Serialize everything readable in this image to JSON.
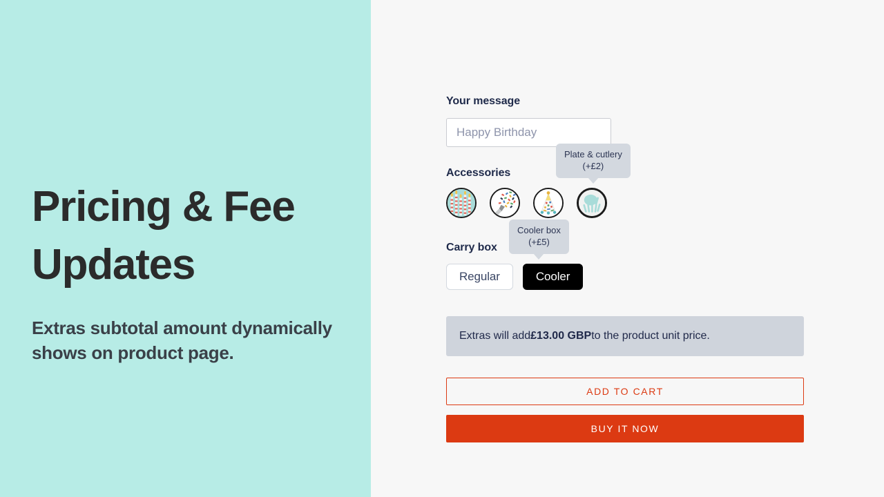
{
  "promo": {
    "headline": "Pricing & Fee Updates",
    "subheadline": "Extras subtotal amount dynamically shows on product page.",
    "background_color": "#B7ECE6"
  },
  "product_form": {
    "message": {
      "label": "Your message",
      "placeholder": "Happy Birthday",
      "value": ""
    },
    "accessories": {
      "label": "Accessories",
      "tooltip": {
        "name": "Plate & cutlery",
        "price": "(+£2)"
      },
      "options": [
        {
          "icon": "birthday-candles-icon",
          "selected": false
        },
        {
          "icon": "confetti-sprinkles-icon",
          "selected": false
        },
        {
          "icon": "party-hat-icon",
          "selected": false
        },
        {
          "icon": "plate-and-cutlery-icon",
          "selected": true
        }
      ]
    },
    "carry_box": {
      "label": "Carry box",
      "tooltip": {
        "name": "Cooler box",
        "price": "(+£5)"
      },
      "options": [
        {
          "label": "Regular",
          "selected": false
        },
        {
          "label": "Cooler",
          "selected": true
        }
      ]
    },
    "extras_notice": {
      "prefix": "Extras will add ",
      "amount": "£13.00 GBP",
      "suffix": " to the product unit price."
    },
    "actions": {
      "add_to_cart": "ADD TO CART",
      "buy_it_now": "BUY IT NOW",
      "accent_color": "#DC3A12"
    }
  }
}
